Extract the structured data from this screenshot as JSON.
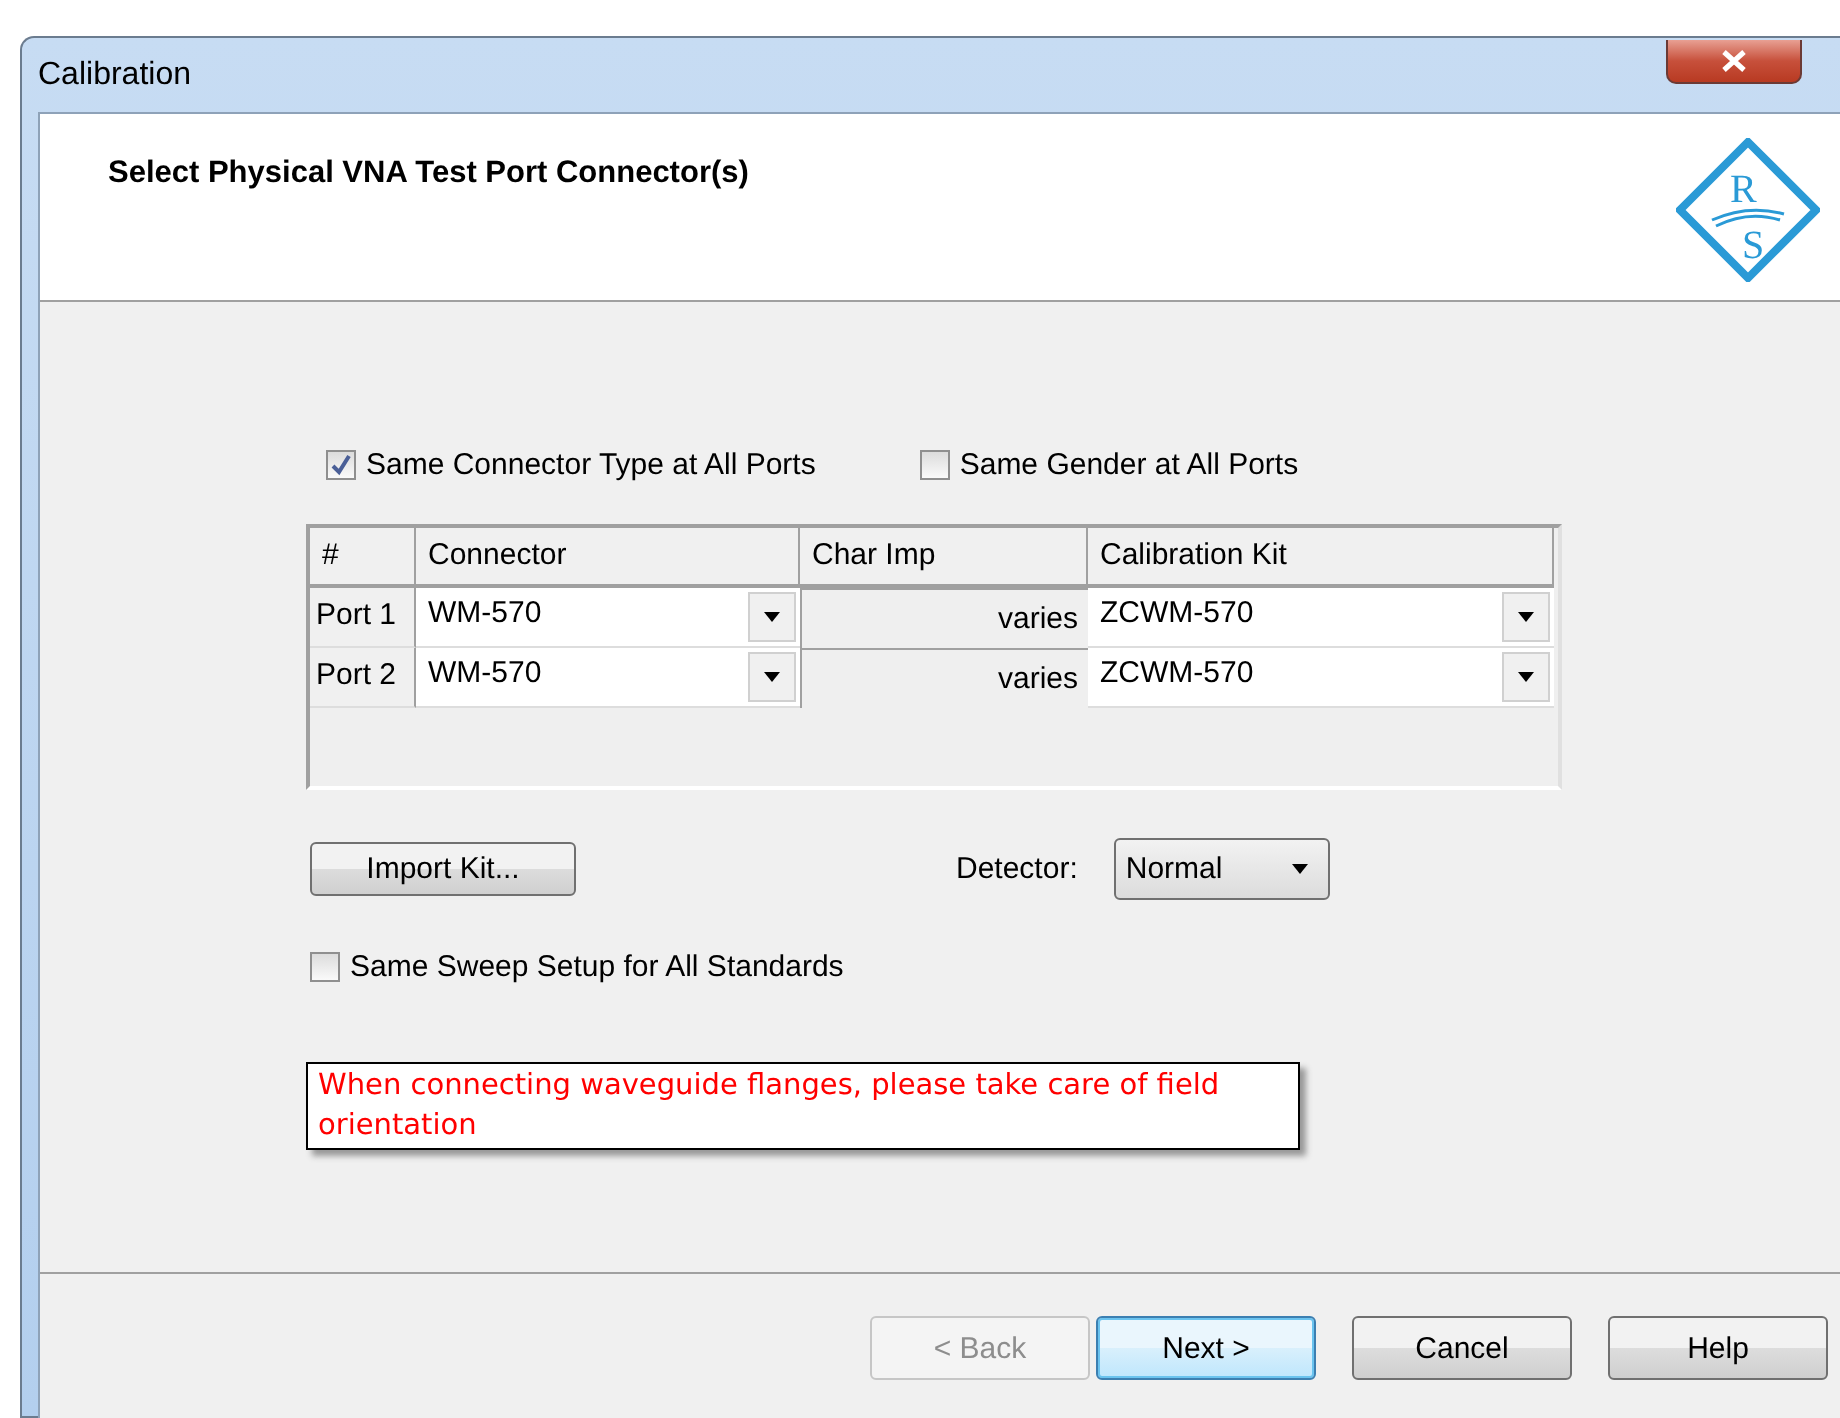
{
  "window": {
    "title": "Calibration"
  },
  "header": {
    "title": "Select Physical VNA Test Port Connector(s)",
    "logo_letters": [
      "R",
      "S"
    ]
  },
  "options": [
    {
      "label": "Same Connector Type at All Ports",
      "checked": true
    },
    {
      "label": "Same Gender at All Ports",
      "checked": false
    }
  ],
  "table": {
    "columns": [
      "#",
      "Connector",
      "Char Imp",
      "Calibration Kit"
    ],
    "rows": [
      {
        "port": "Port 1",
        "connector": "WM-570",
        "char_imp": "varies",
        "calibration_kit": "ZCWM-570"
      },
      {
        "port": "Port 2",
        "connector": "WM-570",
        "char_imp": "varies",
        "calibration_kit": "ZCWM-570"
      }
    ]
  },
  "import_button": "Import Kit...",
  "detector": {
    "label": "Detector:",
    "value": "Normal"
  },
  "sweep_option": {
    "label": "Same Sweep Setup for All Standards",
    "checked": false
  },
  "warning": "When connecting waveguide flanges, please take care of field orientation",
  "buttons": [
    {
      "label": "< Back",
      "disabled": true,
      "default": false
    },
    {
      "label": "Next >",
      "disabled": false,
      "default": true
    },
    {
      "label": "Cancel",
      "disabled": false,
      "default": false
    },
    {
      "label": "Help",
      "disabled": false,
      "default": false
    }
  ]
}
